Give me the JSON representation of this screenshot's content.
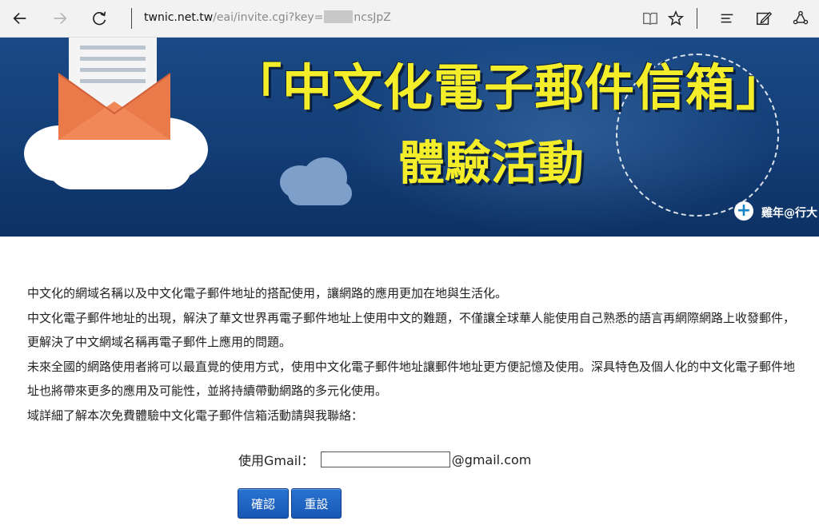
{
  "browser": {
    "url_host": "twnic.net.tw",
    "url_path_before": "/eai/invite.cgi?key=",
    "url_path_after": "ncsJpZ",
    "icons": [
      "back-arrow-icon",
      "forward-arrow-icon",
      "refresh-icon",
      "reading-view-icon",
      "favorite-star-icon",
      "hub-icon",
      "web-note-icon",
      "share-icon"
    ]
  },
  "banner": {
    "title_main": "「中文化電子郵件信箱」",
    "title_sub": "體驗活動",
    "credit": "雞年@行大",
    "colors": {
      "title": "#f4ee2a",
      "background": "#123c74"
    }
  },
  "content": {
    "paragraphs": [
      "中文化的網域名稱以及中文化電子郵件地址的搭配使用，讓網路的應用更加在地與生活化。",
      "中文化電子郵件地址的出現，解決了華文世界再電子郵件地址上使用中文的難題，不僅讓全球華人能使用自己熟悉的語言再網際網路上收發郵件，更解決了中文網域名稱再電子郵件上應用的問題。",
      "未來全國的網路使用者將可以最直覺的使用方式，使用中文化電子郵件地址讓郵件地址更方便記憶及使用。深具特色及個人化的中文化電子郵件地址也將帶來更多的應用及可能性，並將持續帶動網路的多元化使用。",
      "域詳細了解本次免費體驗中文化電子郵件信箱活動請與我聯絡："
    ]
  },
  "form": {
    "label": "使用Gmail：",
    "input_value": "",
    "suffix": "@gmail.com",
    "confirm_label": "確認",
    "reset_label": "重設",
    "button_color": "#1757b3"
  }
}
